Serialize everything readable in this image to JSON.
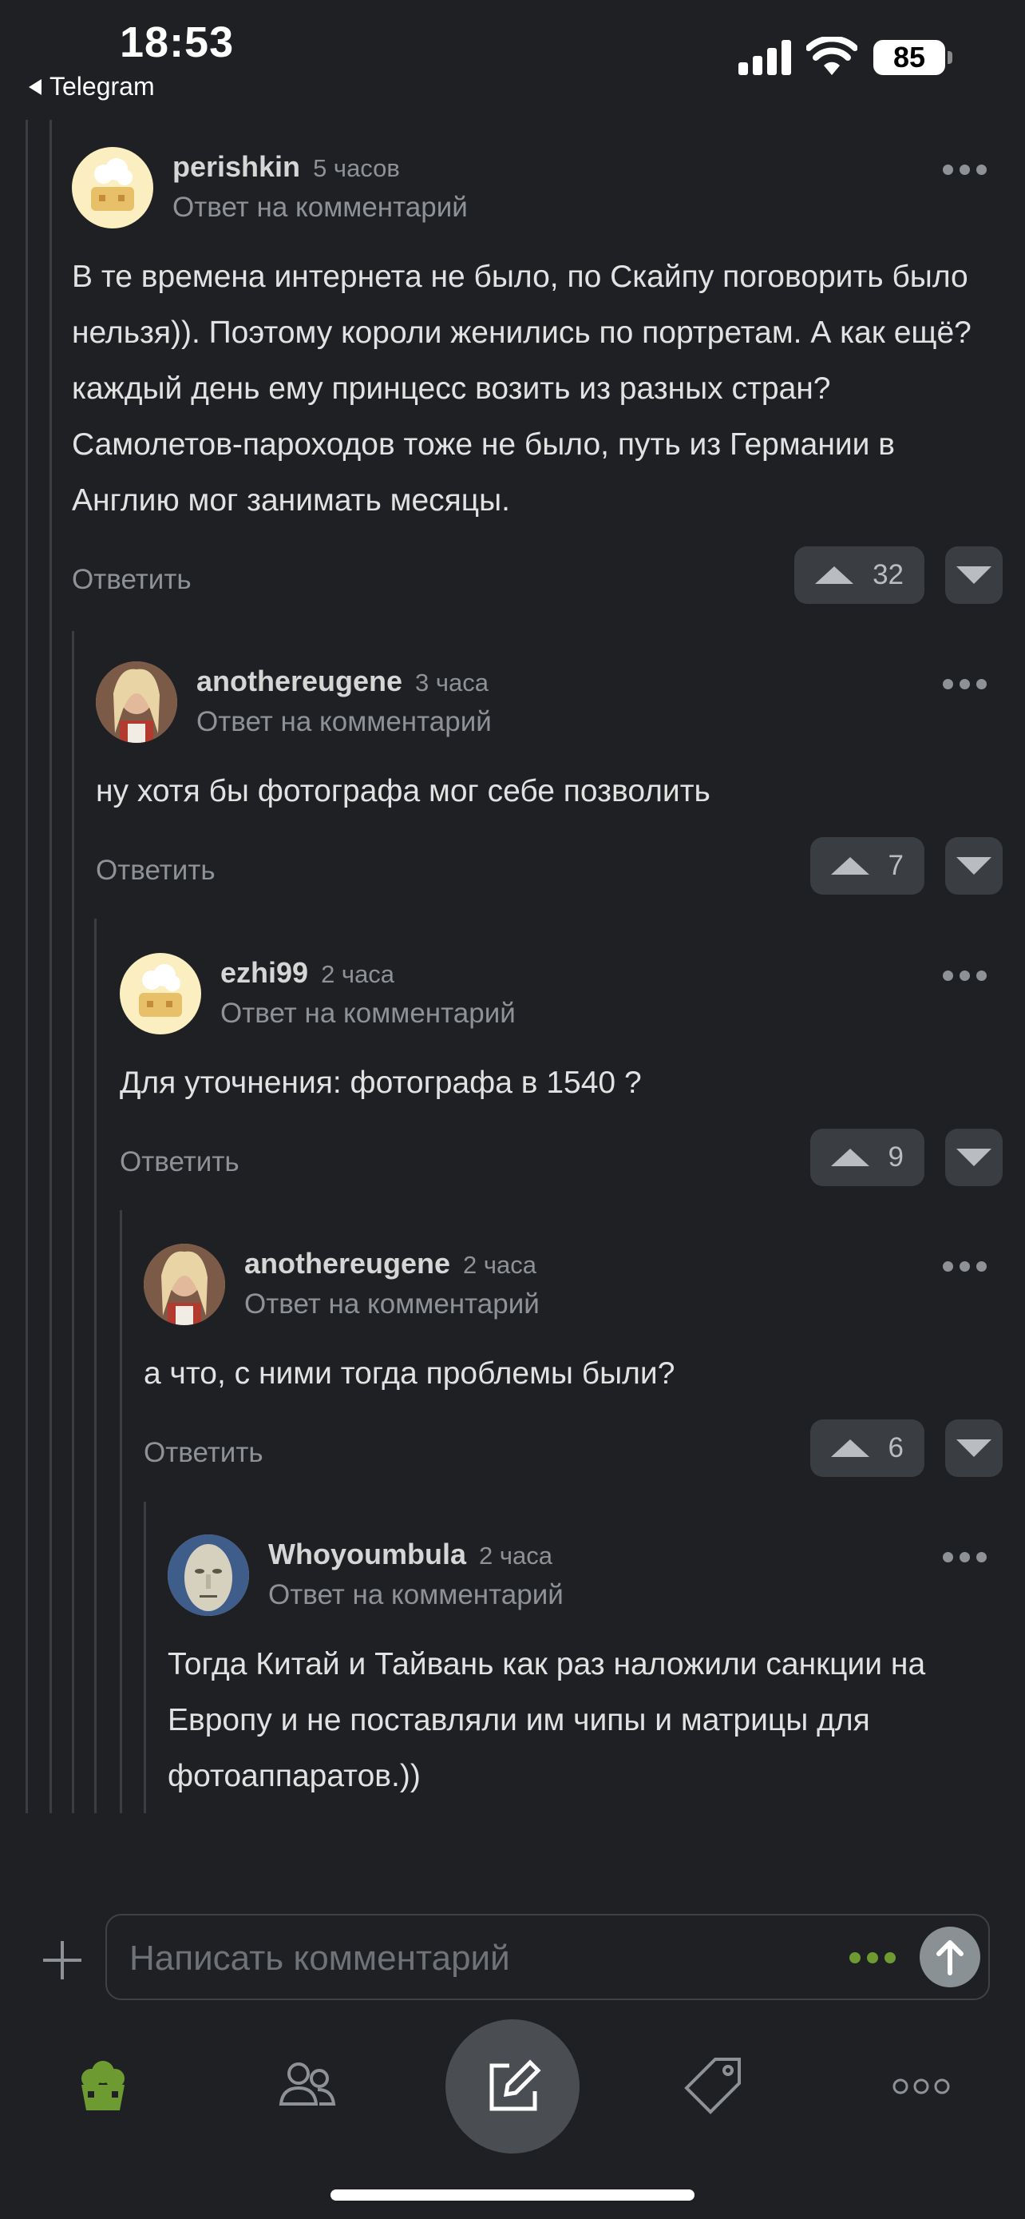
{
  "status_bar": {
    "time": "18:53",
    "back_label": "Telegram",
    "battery": "85"
  },
  "comments": [
    {
      "author": "perishkin",
      "time": "5 часов",
      "reply_label": "Ответ на комментарий",
      "avatar": "cake-avatar",
      "text": "В те времена интернета не было, по Скайпу поговорить было нельзя)). Поэтому короли женились по портретам. А как ещё? каждый день ему принцесс возить из разных стран? Самолетов-пароходов тоже не было, путь из Германии в Англию мог занимать месяцы.",
      "reply_button": "Ответить",
      "votes": "32"
    },
    {
      "author": "anothereugene",
      "time": "3 часа",
      "reply_label": "Ответ на комментарий",
      "avatar": "girl-avatar",
      "text": "ну хотя бы фотографа мог себе позволить",
      "reply_button": "Ответить",
      "votes": "7"
    },
    {
      "author": "ezhi99",
      "time": "2 часа",
      "reply_label": "Ответ на комментарий",
      "avatar": "cake-avatar",
      "text": "Для уточнения: фотографа в 1540 ?",
      "reply_button": "Ответить",
      "votes": "9"
    },
    {
      "author": "anothereugene",
      "time": "2 часа",
      "reply_label": "Ответ на комментарий",
      "avatar": "girl-avatar",
      "text": "а что, с ними тогда проблемы были?",
      "reply_button": "Ответить",
      "votes": "6"
    },
    {
      "author": "Whoyoumbula",
      "time": "2 часа",
      "reply_label": "Ответ на комментарий",
      "avatar": "stone-face-avatar",
      "text": "Тогда Китай и Тайвань как раз наложили санкции на Европу и не поставляли им чипы и матрицы для фотоаппаратов.))"
    }
  ],
  "composer": {
    "placeholder": "Написать комментарий"
  },
  "nav": {
    "items": [
      "home-icon",
      "community-icon",
      "compose-icon",
      "tag-icon",
      "more-icon"
    ]
  },
  "colors": {
    "background": "#1e2023",
    "accent_green": "#6e9a32",
    "muted_text": "#8e9196"
  }
}
